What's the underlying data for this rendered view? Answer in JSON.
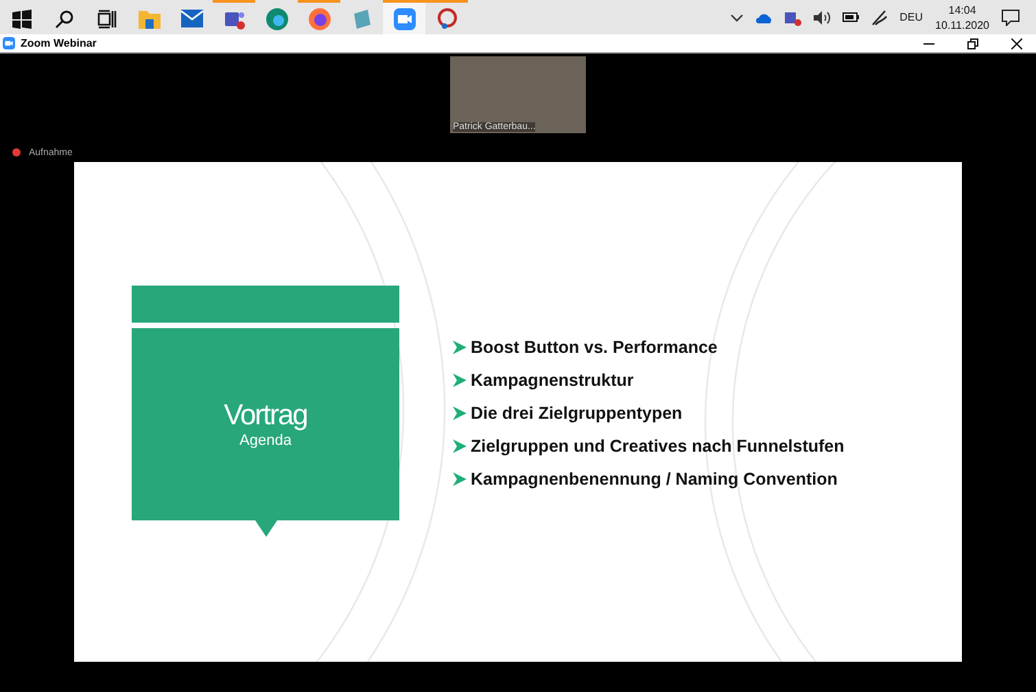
{
  "taskbar": {
    "apps": [
      {
        "kind": "start",
        "running": false,
        "selected": false
      },
      {
        "kind": "search",
        "running": false,
        "selected": false
      },
      {
        "kind": "taskview",
        "running": false,
        "selected": false
      },
      {
        "kind": "folder",
        "running": false,
        "selected": false
      },
      {
        "kind": "mail",
        "running": false,
        "selected": false
      },
      {
        "kind": "teams",
        "running": true,
        "selected": false
      },
      {
        "kind": "edge",
        "running": false,
        "selected": false
      },
      {
        "kind": "firefox",
        "running": true,
        "selected": false
      },
      {
        "kind": "notepad",
        "running": false,
        "selected": false
      },
      {
        "kind": "zoom",
        "running": true,
        "selected": true
      },
      {
        "kind": "paint",
        "running": true,
        "selected": false
      }
    ],
    "language": "DEU",
    "time": "14:04",
    "date": "10.11.2020"
  },
  "window": {
    "title": "Zoom Webinar"
  },
  "video": {
    "name": "Patrick Gatterbau..."
  },
  "recording": {
    "label": "Aufnahme"
  },
  "slide": {
    "title": "Vortrag",
    "subtitle": "Agenda",
    "bullets": [
      "Boost Button vs. Performance",
      "Kampagnenstruktur",
      "Die drei Zielgruppentypen",
      "Zielgruppen und Creatives nach Funnelstufen",
      "Kampagnenbenennung / Naming Convention"
    ]
  }
}
